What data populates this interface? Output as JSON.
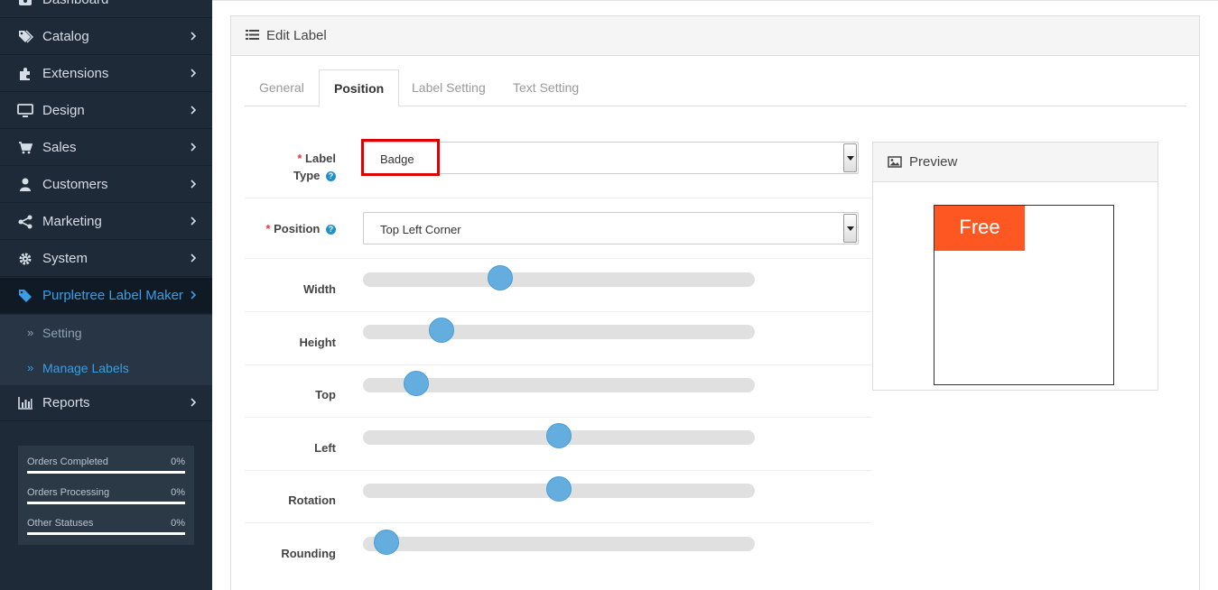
{
  "sidebar": {
    "items": [
      {
        "label": "Dashboard",
        "icon": "dashboard-icon"
      },
      {
        "label": "Catalog",
        "icon": "tags-icon"
      },
      {
        "label": "Extensions",
        "icon": "puzzle-icon"
      },
      {
        "label": "Design",
        "icon": "desktop-icon"
      },
      {
        "label": "Sales",
        "icon": "cart-icon"
      },
      {
        "label": "Customers",
        "icon": "user-icon"
      },
      {
        "label": "Marketing",
        "icon": "share-icon"
      },
      {
        "label": "System",
        "icon": "gear-icon"
      },
      {
        "label": "Purpletree Label Maker",
        "icon": "tag-icon"
      },
      {
        "label": "Reports",
        "icon": "bar-chart-icon"
      }
    ],
    "sub_items": [
      {
        "label": "Setting"
      },
      {
        "label": "Manage Labels"
      }
    ],
    "stats": [
      {
        "name": "Orders Completed",
        "value": "0%",
        "progress": 0
      },
      {
        "name": "Orders Processing",
        "value": "0%",
        "progress": 0
      },
      {
        "name": "Other Statuses",
        "value": "0%",
        "progress": 0
      }
    ]
  },
  "panel": {
    "title": "Edit Label",
    "tabs": [
      {
        "label": "General"
      },
      {
        "label": "Position"
      },
      {
        "label": "Label Setting"
      },
      {
        "label": "Text Setting"
      }
    ],
    "active_tab": "Position"
  },
  "form": {
    "required_mark": "*",
    "help_glyph": "?",
    "label_type": {
      "label_line1": "Label",
      "label_line2": "Type",
      "value": "Badge"
    },
    "position": {
      "label": "Position",
      "value": "Top Left Corner"
    },
    "sliders": [
      {
        "label": "Width",
        "value": 0.34
      },
      {
        "label": "Height",
        "value": 0.18
      },
      {
        "label": "Top",
        "value": 0.11
      },
      {
        "label": "Left",
        "value": 0.5
      },
      {
        "label": "Rotation",
        "value": 0.5
      },
      {
        "label": "Rounding",
        "value": 0.03
      }
    ]
  },
  "preview": {
    "title": "Preview",
    "badge_text": "Free",
    "badge_color": "#ff5722"
  },
  "colors": {
    "sidebar_bg": "#1e2a37",
    "accent": "#3a9ee6",
    "slider_knob": "#64aedf",
    "highlight": "#e00000"
  }
}
